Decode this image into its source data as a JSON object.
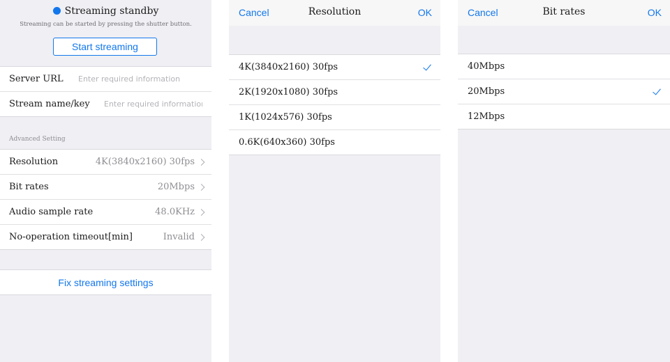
{
  "settings": {
    "status": {
      "label": "Streaming standby",
      "hint": "Streaming can be started by pressing the shutter button.",
      "dot_color": "#1277ec"
    },
    "start_button": "Start streaming",
    "fields": [
      {
        "label": "Server URL",
        "placeholder": "Enter required information",
        "value": ""
      },
      {
        "label": "Stream name/key",
        "placeholder": "Enter required information",
        "value": ""
      }
    ],
    "advanced_heading": "Advanced Setting",
    "advanced": [
      {
        "label": "Resolution",
        "value": "4K(3840x2160) 30fps"
      },
      {
        "label": "Bit rates",
        "value": "20Mbps"
      },
      {
        "label": "Audio sample rate",
        "value": "48.0KHz"
      },
      {
        "label": "No-operation timeout[min]",
        "value": "Invalid"
      }
    ],
    "fix_button": "Fix streaming settings"
  },
  "resolution_picker": {
    "cancel": "Cancel",
    "title": "Resolution",
    "ok": "OK",
    "options": [
      {
        "label": "4K(3840x2160) 30fps",
        "selected": true
      },
      {
        "label": "2K(1920x1080) 30fps",
        "selected": false
      },
      {
        "label": "1K(1024x576) 30fps",
        "selected": false
      },
      {
        "label": "0.6K(640x360) 30fps",
        "selected": false
      }
    ]
  },
  "bitrate_picker": {
    "cancel": "Cancel",
    "title": "Bit rates",
    "ok": "OK",
    "options": [
      {
        "label": "40Mbps",
        "selected": false
      },
      {
        "label": "20Mbps",
        "selected": true
      },
      {
        "label": "12Mbps",
        "selected": false
      }
    ]
  },
  "colors": {
    "accent": "#1277ec",
    "background": "#efeff4"
  }
}
